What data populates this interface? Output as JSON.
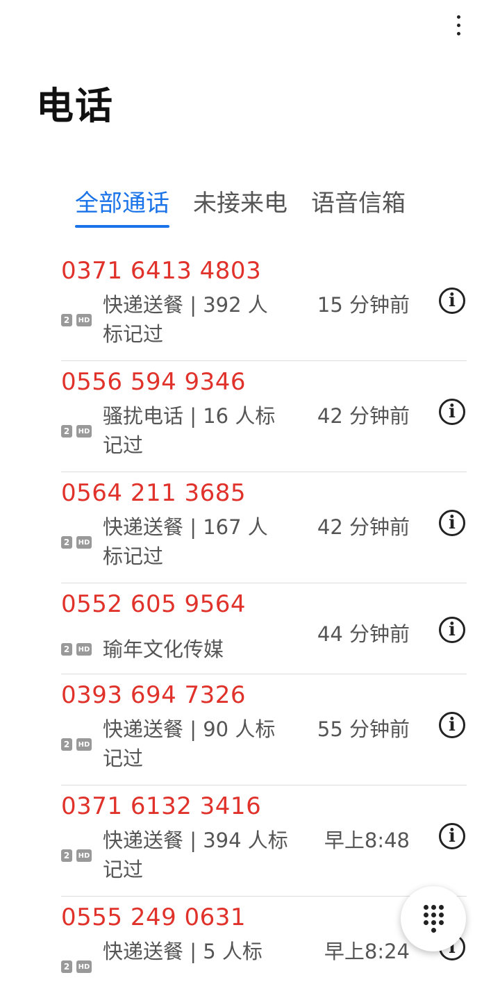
{
  "header": {
    "title": "电话",
    "more_icon": "more-vert-icon"
  },
  "tabs": [
    {
      "label": "全部通话",
      "active": true
    },
    {
      "label": "未接来电",
      "active": false
    },
    {
      "label": "语音信箱",
      "active": false
    }
  ],
  "colors": {
    "accent": "#1a73e8",
    "number": "#e0312a",
    "badge": "#999999"
  },
  "calls": [
    {
      "number": "0371 6413 4803",
      "sim": "2",
      "hd": "HD",
      "desc_line1": "快递送餐 | 392 人",
      "desc_line2": "标记过",
      "time": "15 分钟前"
    },
    {
      "number": "0556 594 9346",
      "sim": "2",
      "hd": "HD",
      "desc_line1": "骚扰电话 | 16 人标",
      "desc_line2": "记过",
      "time": "42 分钟前"
    },
    {
      "number": "0564 211 3685",
      "sim": "2",
      "hd": "HD",
      "desc_line1": "快递送餐 | 167 人",
      "desc_line2": "标记过",
      "time": "42 分钟前"
    },
    {
      "number": "0552 605 9564",
      "sim": "2",
      "hd": "HD",
      "desc_line1": "瑜年文化传媒",
      "desc_line2": "",
      "time": "44 分钟前"
    },
    {
      "number": "0393 694 7326",
      "sim": "2",
      "hd": "HD",
      "desc_line1": "快递送餐 | 90 人标",
      "desc_line2": "记过",
      "time": "55 分钟前"
    },
    {
      "number": "0371 6132 3416",
      "sim": "2",
      "hd": "HD",
      "desc_line1": "快递送餐 | 394 人标",
      "desc_line2": "记过",
      "time": "早上8:48"
    },
    {
      "number": "0555 249 0631",
      "sim": "2",
      "hd": "HD",
      "desc_line1": "快递送餐 | 5 人标",
      "desc_line2": "",
      "time": "早上8:24"
    }
  ],
  "fab": {
    "icon": "dialpad-icon"
  }
}
